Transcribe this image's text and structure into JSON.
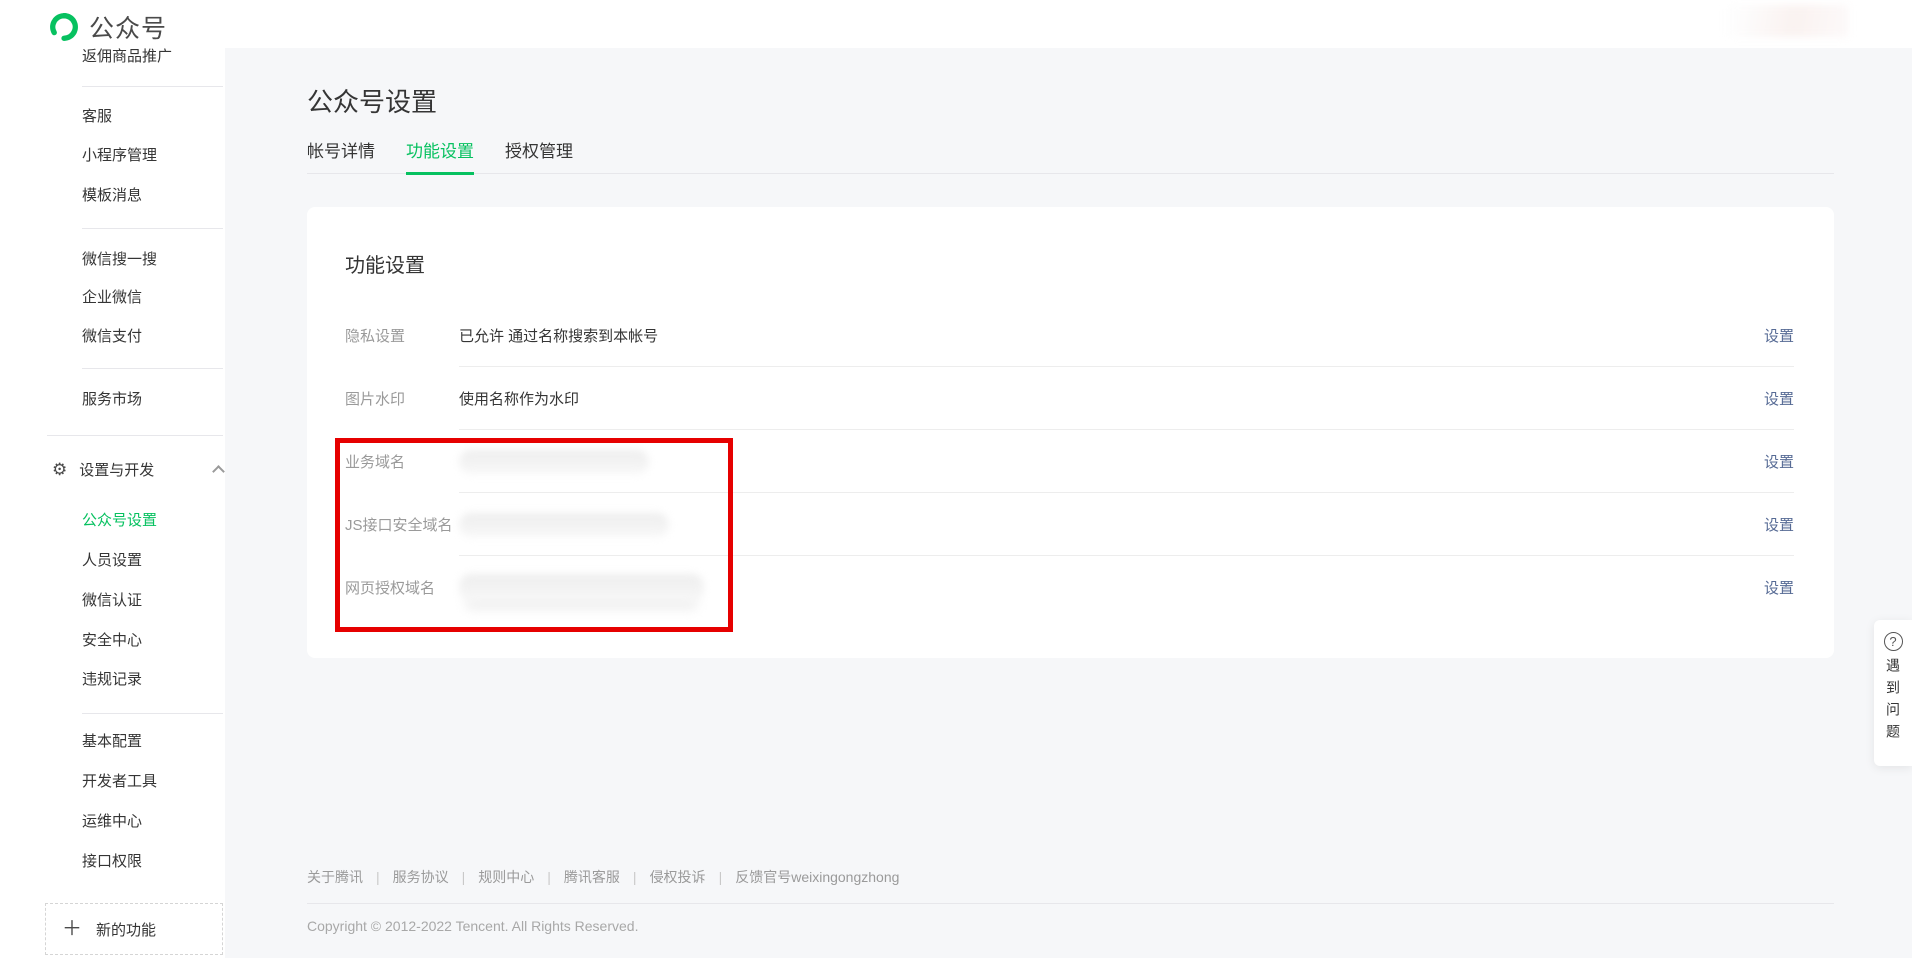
{
  "app": {
    "logo_label": "公众号"
  },
  "icons": {
    "gear": "⚙",
    "plus": "＋",
    "question": "?"
  },
  "sidebar": {
    "items": [
      {
        "label": "返佣商品推广"
      },
      {
        "label": "客服"
      },
      {
        "label": "小程序管理"
      },
      {
        "label": "模板消息"
      },
      {
        "label": "微信搜一搜"
      },
      {
        "label": "企业微信"
      },
      {
        "label": "微信支付"
      },
      {
        "label": "服务市场"
      },
      {
        "label": "设置与开发"
      },
      {
        "label": "公众号设置"
      },
      {
        "label": "人员设置"
      },
      {
        "label": "微信认证"
      },
      {
        "label": "安全中心"
      },
      {
        "label": "违规记录"
      },
      {
        "label": "基本配置"
      },
      {
        "label": "开发者工具"
      },
      {
        "label": "运维中心"
      },
      {
        "label": "接口权限"
      },
      {
        "label": "新的功能"
      }
    ]
  },
  "page": {
    "title": "公众号设置",
    "tabs": [
      {
        "label": "帐号详情"
      },
      {
        "label": "功能设置"
      },
      {
        "label": "授权管理"
      }
    ]
  },
  "card": {
    "heading": "功能设置",
    "rows": [
      {
        "label": "隐私设置",
        "value": "已允许 通过名称搜索到本帐号",
        "action": "设置",
        "redacted": false
      },
      {
        "label": "图片水印",
        "value": "使用名称作为水印",
        "action": "设置",
        "redacted": false
      },
      {
        "label": "业务域名",
        "value": "",
        "action": "设置",
        "redacted": true
      },
      {
        "label": "JS接口安全域名",
        "value": "",
        "action": "设置",
        "redacted": true
      },
      {
        "label": "网页授权域名",
        "value": "",
        "action": "设置",
        "redacted": true
      }
    ]
  },
  "help": {
    "icon": "?",
    "label": "遇到问题"
  },
  "footer": {
    "links": [
      "关于腾讯",
      "服务协议",
      "规则中心",
      "腾讯客服",
      "侵权投诉",
      "反馈官号weixingongzhong"
    ],
    "separator": "|",
    "copyright": "Copyright © 2012-2022 Tencent. All Rights Reserved."
  },
  "colors": {
    "brand_green": "#07c160",
    "link_blue": "#576b95",
    "annotation_red": "#e60000"
  }
}
